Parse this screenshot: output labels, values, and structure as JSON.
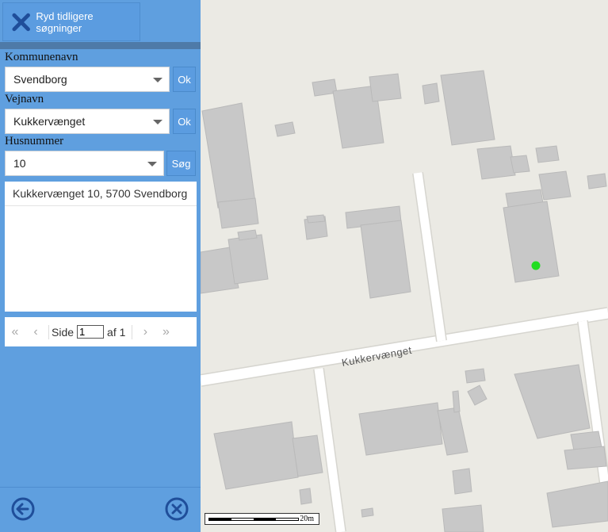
{
  "sidebar": {
    "clear_label": "Ryd tidligere søgninger",
    "municipality": {
      "label": "Kommunenavn",
      "value": "Svendborg",
      "ok_label": "Ok"
    },
    "street": {
      "label": "Vejnavn",
      "value": "Kukkervænget",
      "ok_label": "Ok"
    },
    "house": {
      "label": "Husnummer",
      "value": "10",
      "search_label": "Søg"
    },
    "results": [
      "Kukkervænget 10, 5700 Svendborg"
    ],
    "pager": {
      "page_label": "Side",
      "page_value": "1",
      "of_label": "af 1"
    },
    "colors": {
      "panel": "#5f9fdf",
      "accent": "#1f4e9a"
    }
  },
  "map": {
    "street_label": "Kukkervænget",
    "scale_label": "20m",
    "marker_color": "#22dd22",
    "building_color": "#c8c8c8"
  }
}
